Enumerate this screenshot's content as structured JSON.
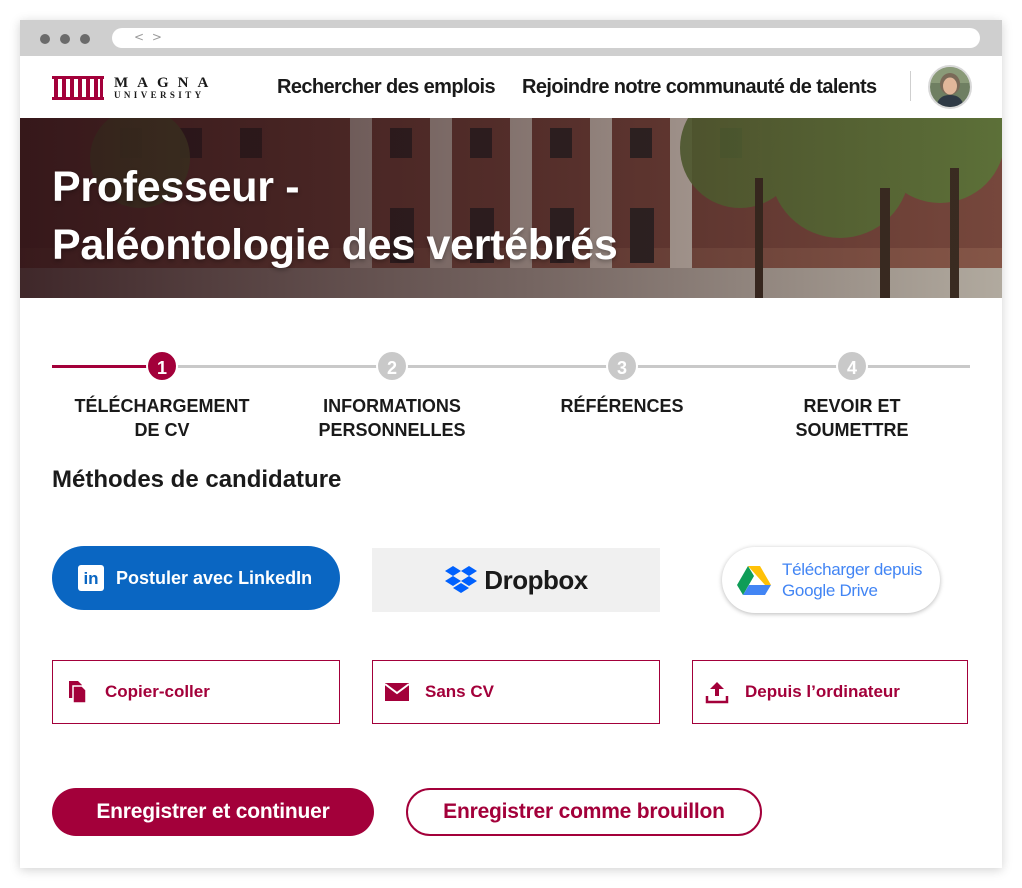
{
  "brand": {
    "name_line1": "MAGNA",
    "name_line2": "UNIVERSITY",
    "color": "#a3003a"
  },
  "header": {
    "nav": [
      "Rechercher des emplois",
      "Rejoindre notre communauté de talents"
    ]
  },
  "hero": {
    "title_line1": "Professeur -",
    "title_line2": "Paléontologie des vertébrés"
  },
  "stepper": {
    "current_step": 1,
    "steps": [
      {
        "number": "1",
        "label_line1": "TÉLÉCHARGEMENT",
        "label_line2": "DE CV"
      },
      {
        "number": "2",
        "label_line1": "INFORMATIONS",
        "label_line2": "PERSONNELLES"
      },
      {
        "number": "3",
        "label_line1": "RÉFÉRENCES",
        "label_line2": ""
      },
      {
        "number": "4",
        "label_line1": "REVOIR ET",
        "label_line2": "SOUMETTRE"
      }
    ]
  },
  "methods": {
    "title": "Méthodes de candidature",
    "linkedin": {
      "label": "Postuler avec LinkedIn",
      "icon_text": "in",
      "color": "#0a66c2"
    },
    "dropbox": {
      "label": "Dropbox",
      "color": "#0061fe"
    },
    "gdrive": {
      "label_line1": "Télécharger depuis",
      "label_line2": "Google Drive"
    },
    "options": [
      {
        "label": "Copier-coller",
        "icon": "copy-icon"
      },
      {
        "label": "Sans CV",
        "icon": "envelope-icon"
      },
      {
        "label": "Depuis l’ordinateur",
        "icon": "upload-icon"
      }
    ]
  },
  "actions": {
    "primary": "Enregistrer et continuer",
    "secondary": "Enregistrer comme brouillon"
  }
}
